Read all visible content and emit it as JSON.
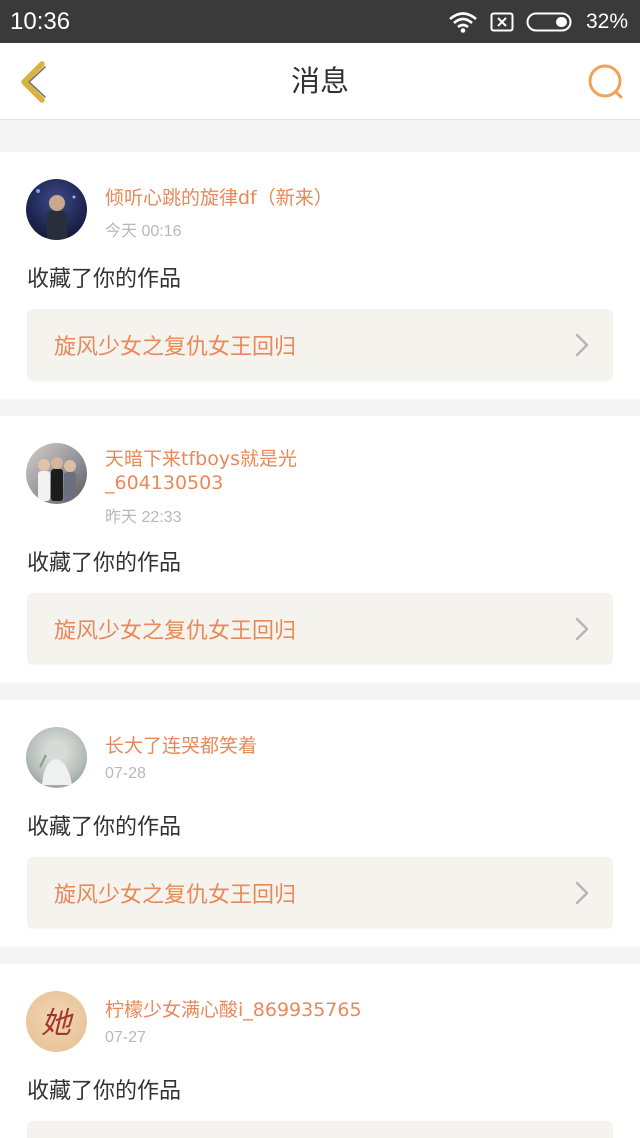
{
  "status_bar": {
    "time": "10:36",
    "battery": "32%",
    "icons": [
      "wifi-icon",
      "sim-off-icon",
      "battery-icon"
    ]
  },
  "header": {
    "title": "消息",
    "back_icon": "chevron-left-icon",
    "search_icon": "search-icon"
  },
  "colors": {
    "accent": "#e8895a",
    "back_icon": "#d9b33a",
    "work_bg": "#f4f3ed"
  },
  "notifications": [
    {
      "user_line1": "倾听心跳的旋律df（新来）",
      "user_line2": "",
      "time": "今天 00:16",
      "action": "收藏了你的作品",
      "work_title": "旋风少女之复仇女王回归"
    },
    {
      "user_line1": "天暗下来tfboys就是光",
      "user_line2": "_604130503",
      "time": "昨天 22:33",
      "action": "收藏了你的作品",
      "work_title": "旋风少女之复仇女王回归"
    },
    {
      "user_line1": "长大了连哭都笑着",
      "user_line2": "",
      "time": "07-28",
      "action": "收藏了你的作品",
      "work_title": "旋风少女之复仇女王回归"
    },
    {
      "user_line1": "柠檬少女满心酸i_869935765",
      "user_line2": "",
      "time": "07-27",
      "action": "收藏了你的作品",
      "work_title": "",
      "avatar_text": "她"
    }
  ]
}
